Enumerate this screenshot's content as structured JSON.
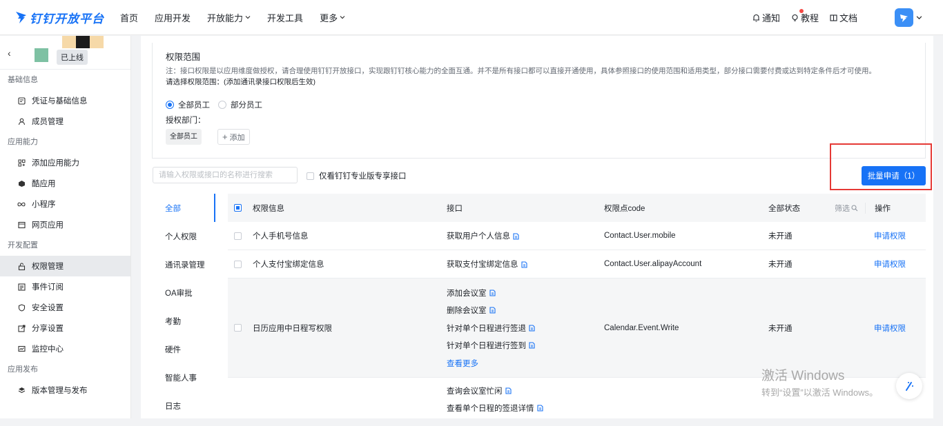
{
  "brand": {
    "name": "钉钉开放平台",
    "color": "#1772f6"
  },
  "nav": {
    "items": [
      {
        "label": "首页",
        "dropdown": false
      },
      {
        "label": "应用开发",
        "dropdown": false
      },
      {
        "label": "开放能力",
        "dropdown": true
      },
      {
        "label": "开发工具",
        "dropdown": false
      },
      {
        "label": "更多",
        "dropdown": true
      }
    ]
  },
  "topright": {
    "notify": "通知",
    "tutorial": "教程",
    "docs": "文档"
  },
  "app": {
    "status": "已上线"
  },
  "sidebar": {
    "groups": [
      {
        "title": "基础信息",
        "items": [
          {
            "label": "凭证与基础信息",
            "icon": "credential-icon"
          },
          {
            "label": "成员管理",
            "icon": "member-icon"
          }
        ]
      },
      {
        "title": "应用能力",
        "items": [
          {
            "label": "添加应用能力",
            "icon": "grid-add-icon"
          },
          {
            "label": "酷应用",
            "icon": "cool-app-icon"
          },
          {
            "label": "小程序",
            "icon": "infinity-icon"
          },
          {
            "label": "网页应用",
            "icon": "webpage-icon"
          }
        ]
      },
      {
        "title": "开发配置",
        "items": [
          {
            "label": "权限管理",
            "icon": "lock-icon",
            "active": true
          },
          {
            "label": "事件订阅",
            "icon": "event-icon"
          },
          {
            "label": "安全设置",
            "icon": "shield-icon"
          },
          {
            "label": "分享设置",
            "icon": "share-icon"
          },
          {
            "label": "监控中心",
            "icon": "monitor-icon"
          }
        ]
      },
      {
        "title": "应用发布",
        "items": [
          {
            "label": "版本管理与发布",
            "icon": "layers-icon"
          }
        ]
      }
    ]
  },
  "scope": {
    "title": "权限范围",
    "note": "注：接口权限是以应用维度做授权，请合理使用钉钉开放接口，实现跟钉钉核心能力的全面互通。并不是所有接口都可以直接开通使用，具体参照接口的使用范围和适用类型，部分接口需要付费或达到特定条件后才可使用。",
    "select_hint": "请选择权限范围：(添加通讯录接口权限后生效)",
    "radio_all": "全部员工",
    "radio_part": "部分员工",
    "dept_label": "授权部门：",
    "dept_tag": "全部员工",
    "add_label": "添加"
  },
  "search": {
    "placeholder": "请输入权限或接口的名称进行搜索",
    "value": ""
  },
  "only_pro_label": "仅看钉钉专业版专享接口",
  "batch_button": "批量申请（1）",
  "categories": [
    "全部",
    "个人权限",
    "通讯录管理",
    "OA审批",
    "考勤",
    "硬件",
    "智能人事",
    "日志"
  ],
  "table": {
    "headers": {
      "perm": "权限信息",
      "api": "接口",
      "code": "权限点code",
      "status": "全部状态",
      "filter": "筛选",
      "action": "操作"
    },
    "rows": [
      {
        "perm": "个人手机号信息",
        "apis": [
          "获取用户个人信息"
        ],
        "code": "Contact.User.mobile",
        "status": "未开通",
        "action": "申请权限"
      },
      {
        "perm": "个人支付宝绑定信息",
        "apis": [
          "获取支付宝绑定信息"
        ],
        "code": "Contact.User.alipayAccount",
        "status": "未开通",
        "action": "申请权限"
      },
      {
        "perm": "日历应用中日程写权限",
        "apis": [
          "添加会议室",
          "删除会议室",
          "针对单个日程进行签退",
          "针对单个日程进行签到"
        ],
        "more": "查看更多",
        "code": "Calendar.Event.Write",
        "status": "未开通",
        "action": "申请权限"
      },
      {
        "perm": "",
        "apis": [
          "查询会议室忙闲",
          "查看单个日程的签退详情"
        ],
        "code": "",
        "status": "",
        "action": ""
      }
    ]
  },
  "watermark": {
    "line1": "激活 Windows",
    "line2": "转到“设置”以激活 Windows。"
  }
}
